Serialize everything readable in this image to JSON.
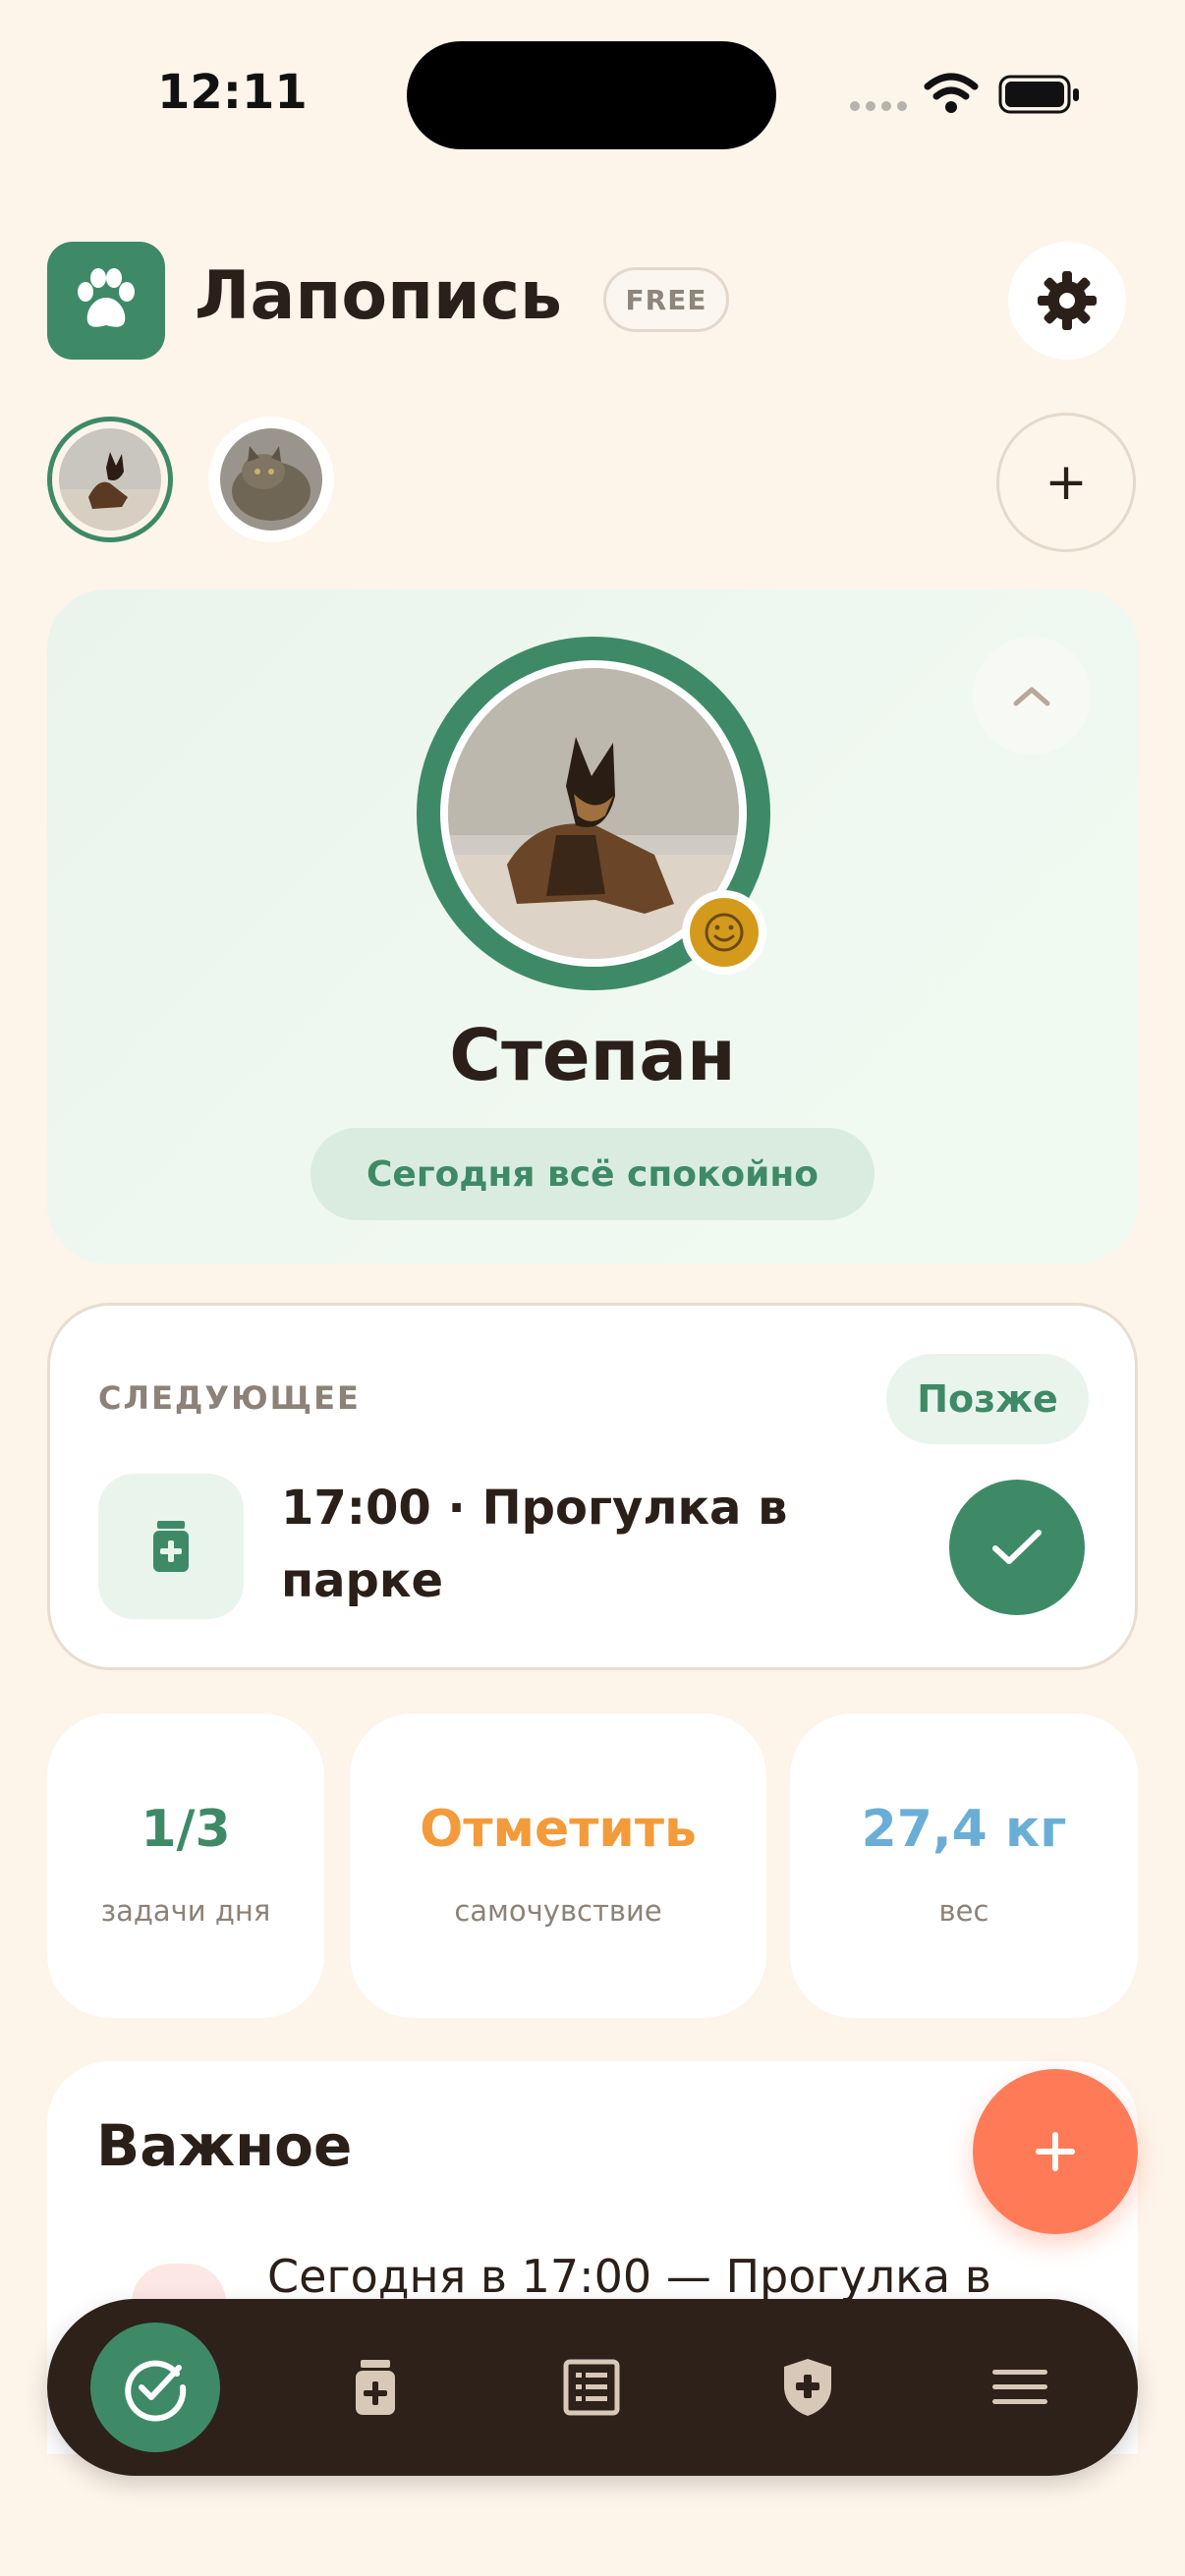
{
  "status_bar": {
    "time": "12:11"
  },
  "header": {
    "title": "Лапопись",
    "plan_badge": "FREE"
  },
  "pets": {
    "add_label": "+"
  },
  "hero": {
    "name": "Степан",
    "status": "Сегодня всё спокойно"
  },
  "next": {
    "label": "СЛЕДУЮЩЕЕ",
    "later": "Позже",
    "task": "17:00 · Прогулка в парке"
  },
  "stats": [
    {
      "value": "1/3",
      "label": "задачи дня",
      "color": "#3e8a67"
    },
    {
      "value": "Отметить",
      "label": "самочувствие",
      "color": "#f39b3a"
    },
    {
      "value": "27,4 кг",
      "label": "вес",
      "color": "#6aaed6"
    }
  ],
  "important": {
    "title": "Важное",
    "row_text": "Сегодня в 17:00 — Прогулка в"
  },
  "fab": {
    "label": "+"
  },
  "colors": {
    "background": "#fdf4ea",
    "accent_green": "#3e8a67",
    "fab": "#ff7b58",
    "nav_bg": "#2d2119"
  },
  "nav": {
    "items": [
      {
        "icon": "check-circle-icon",
        "active": true
      },
      {
        "icon": "medicine-icon"
      },
      {
        "icon": "journal-icon"
      },
      {
        "icon": "shield-plus-icon"
      },
      {
        "icon": "menu-icon"
      }
    ]
  }
}
